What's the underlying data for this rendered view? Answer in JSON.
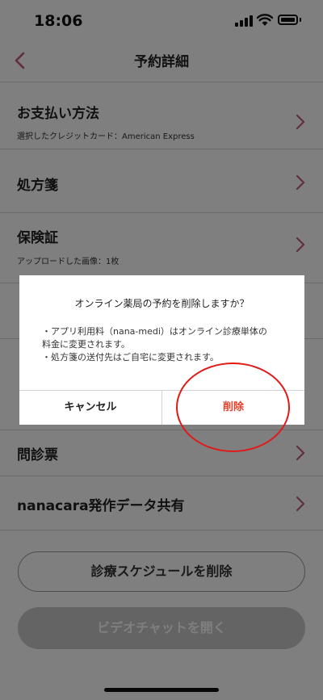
{
  "status_bar": {
    "time": "18:06"
  },
  "nav": {
    "title": "予約詳細"
  },
  "rows": [
    {
      "title": "お支払い方法",
      "subtitle": "選択したクレジットカード：American Express"
    },
    {
      "title": "処方箋"
    },
    {
      "title": "保険証",
      "subtitle": "アップロードした画像：1枚"
    },
    {
      "title": "問診票"
    },
    {
      "title": "nanacara発作データ共有"
    }
  ],
  "buttons": {
    "delete_schedule": "診療スケジュールを削除",
    "open_video_chat": "ビデオチャットを開く"
  },
  "dialog": {
    "title": "オンライン薬局の予約を削除しますか？",
    "body_line1": "・アプリ利用料（nana-medi）はオンライン診療単体の",
    "body_line2": "料金に変更されます。",
    "body_line3": "・処方箋の送付先はご自宅に変更されます。",
    "cancel_label": "キャンセル",
    "delete_label": "削除"
  },
  "colors": {
    "accent_pink": "#c05a7f",
    "delete_red": "#e8412c",
    "highlight_circle": "#e01919"
  }
}
